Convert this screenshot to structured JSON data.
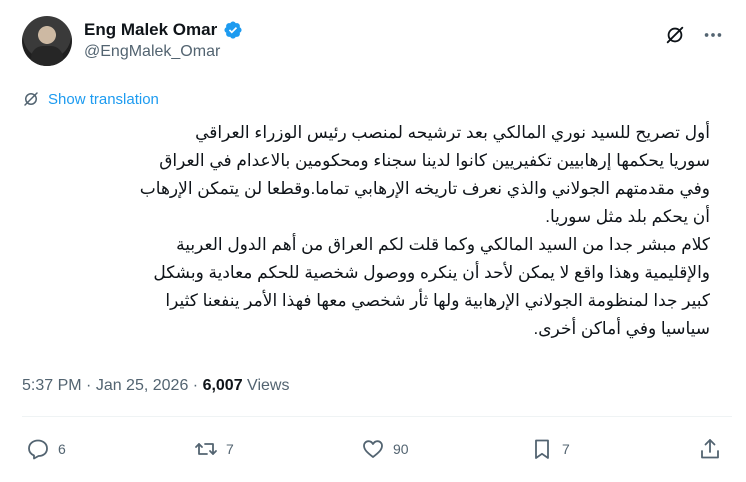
{
  "author": {
    "display_name": "Eng Malek Omar",
    "handle": "@EngMalek_Omar",
    "verified": true
  },
  "header_icons": [
    "grok-icon",
    "more-icon"
  ],
  "translate": {
    "label": "Show translation",
    "icon": "translate-icon"
  },
  "tweet": {
    "paragraphs": [
      "أول تصريح للسيد نوري المالكي بعد ترشيحه لمنصب رئيس الوزراء العراقي",
      "سوريا يحكمها إرهابيين تكفيريين كانوا لدينا سجناء ومحكومين بالاعدام في العراق",
      "وفي مقدمتهم الجولاني والذي نعرف تاريخه الإرهابي تماما.وقطعا لن يتمكن الإرهاب",
      "أن يحكم بلد مثل سوريا.",
      "كلام مبشر جدا من السيد المالكي وكما قلت لكم العراق من أهم الدول العربية",
      "والإقليمية وهذا واقع لا يمكن لأحد أن ينكره ووصول شخصية للحكم  معادية وبشكل",
      "كبير جدا لمنظومة الجولاني الإرهابية ولها ثأر شخصي معها فهذا الأمر ينفعنا كثيرا",
      "سياسيا وفي أماكن أخرى."
    ]
  },
  "meta": {
    "time": "5:37 PM",
    "separator": " · ",
    "date": "Jan 25, 2026",
    "views_count": "6,007",
    "views_label": " Views"
  },
  "actions": {
    "reply": {
      "count": "6",
      "icon": "reply-icon"
    },
    "repost": {
      "count": "7",
      "icon": "repost-icon"
    },
    "like": {
      "count": "90",
      "icon": "like-icon"
    },
    "bookmark": {
      "count": "7",
      "icon": "bookmark-icon"
    },
    "share": {
      "icon": "share-icon"
    }
  },
  "colors": {
    "accent": "#1d9bf0",
    "text_primary": "#0f1419",
    "text_secondary": "#536471"
  }
}
